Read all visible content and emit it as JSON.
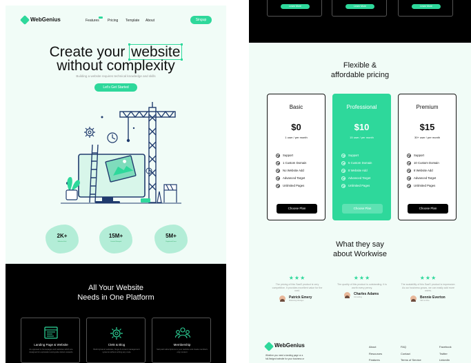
{
  "colors": {
    "accent": "#2ed89b",
    "dark": "#000000",
    "bg_mint": "#f1fcf7"
  },
  "nav": {
    "brand": "WebGenius",
    "links": [
      "Features",
      "Pricing",
      "Template",
      "About"
    ],
    "signup": "Singup"
  },
  "hero": {
    "title_pre": "Create your",
    "title_highlight": "website",
    "title_line2": "without complexity",
    "subtitle": "Building a website requires technical knowledge and skills",
    "cta": "Let's Get Started"
  },
  "stats": [
    {
      "value": "2K+",
      "label": "Websites Built"
    },
    {
      "value": "15M+",
      "label": "Content Managed"
    },
    {
      "value": "5M+",
      "label": "Registered Users"
    }
  ],
  "platform": {
    "title_line1": "All Your Website",
    "title_line2": "Needs in One Platform",
    "features": [
      {
        "icon": "layout-icon",
        "title": "Landing Page & Website",
        "desc": "As opposed to homepages and websites which are designed for exploration and guide visitors towards"
      },
      {
        "icon": "gear-icon",
        "title": "CMS & Blog",
        "desc": "Build dynamic websites, blogs & content management systems without writing any code"
      },
      {
        "icon": "users-icon",
        "title": "Membership",
        "desc": "Sell paid subscriptions to your website and create members only content"
      }
    ],
    "learn_more": "Learn More"
  },
  "pricing": {
    "title_line1": "Flexible &",
    "title_line2": "affordable pricing",
    "plans": [
      {
        "name": "Basic",
        "price": "$0",
        "period": "1 user / per month",
        "features": [
          "Support",
          "1 Custom Domain",
          "No Website Add",
          "Advanced Target",
          "Unlimited Pages"
        ],
        "cta": "Choose Plan"
      },
      {
        "name": "Professional",
        "price": "$10",
        "period": "15 user / per month",
        "features": [
          "Support",
          "5 Custom Domain",
          "8 Website Add",
          "Advanced Target",
          "Unlimited Pages"
        ],
        "cta": "Choose Plan"
      },
      {
        "name": "Premium",
        "price": "$15",
        "period": "30+ user / per month",
        "features": [
          "Support",
          "10 Custom Domain",
          "8 Website Add",
          "Advanced Target",
          "Unlimited Pages"
        ],
        "cta": "Choose Plan"
      }
    ]
  },
  "testimonials": {
    "title_line1": "What they say",
    "title_line2": "about Workwise",
    "items": [
      {
        "stars": "★★★",
        "quote": "The pricing of this SaaS product is very competitive. It provides excellent value for the cost.",
        "name": "Patrick Emery",
        "role": "Marketing Manager"
      },
      {
        "stars": "★★★",
        "quote": "The quality of this product is outstanding. It is worth every penny.",
        "name": "Charles Adams",
        "role": "Consulting"
      },
      {
        "stars": "★★★",
        "quote": "The scalability of this SaaS product is impressive. As our business grows, we can easily add more users.",
        "name": "Bennie Everton",
        "role": "CEO at Mos"
      }
    ]
  },
  "footer": {
    "brand": "WebGenius",
    "desc_line1": "Whether you need a landing page or a",
    "desc_line2": "full-fledged website for your business or",
    "col1": [
      "About",
      "Resources",
      "Features"
    ],
    "col2": [
      "FAQ",
      "Contact",
      "Terms of Service"
    ],
    "col3": [
      "Facebook",
      "Twitter",
      "LinkedIn"
    ]
  }
}
